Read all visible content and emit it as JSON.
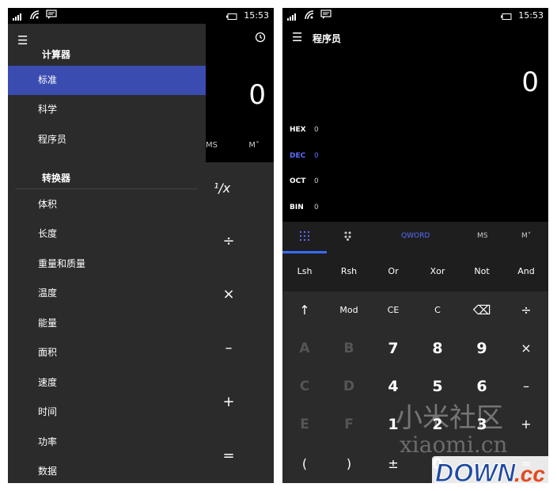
{
  "status": {
    "time": "15:53"
  },
  "left": {
    "drawer_title": "计算器",
    "calculator_items": [
      "标准",
      "科学",
      "程序员"
    ],
    "converter_title": "转换器",
    "converter_items": [
      "体积",
      "长度",
      "重量和质量",
      "温度",
      "能量",
      "面积",
      "速度",
      "时间",
      "功率",
      "数据"
    ],
    "background": {
      "display": "0",
      "ms": "MS",
      "mplus": "M˅",
      "recip": "¹/x",
      "ops": [
        "÷",
        "×",
        "–",
        "+",
        "="
      ]
    }
  },
  "right": {
    "title": "程序员",
    "display": "0",
    "bases": [
      {
        "name": "HEX",
        "value": "0"
      },
      {
        "name": "DEC",
        "value": "0"
      },
      {
        "name": "OCT",
        "value": "0"
      },
      {
        "name": "BIN",
        "value": "0"
      }
    ],
    "tabs": {
      "word": "QWORD",
      "ms": "MS",
      "mplus": "M˅"
    },
    "bit_ops": [
      "Lsh",
      "Rsh",
      "Or",
      "Xor",
      "Not",
      "And"
    ],
    "keys": [
      [
        "↑",
        "Mod",
        "CE",
        "C",
        "⌫",
        "÷"
      ],
      [
        "A",
        "B",
        "7",
        "8",
        "9",
        "×"
      ],
      [
        "C",
        "D",
        "4",
        "5",
        "6",
        "–"
      ],
      [
        "E",
        "F",
        "1",
        "2",
        "3",
        "+"
      ],
      [
        "(",
        ")",
        "±",
        "0",
        ".",
        "="
      ]
    ]
  },
  "watermark": {
    "line1": "小米社区",
    "line2": "xiaomi.cn",
    "logo": "DOWN.cc"
  },
  "colors": {
    "accent": "#3a4cb0",
    "active_text": "#5a6cff",
    "panel": "#2b2b2b"
  }
}
